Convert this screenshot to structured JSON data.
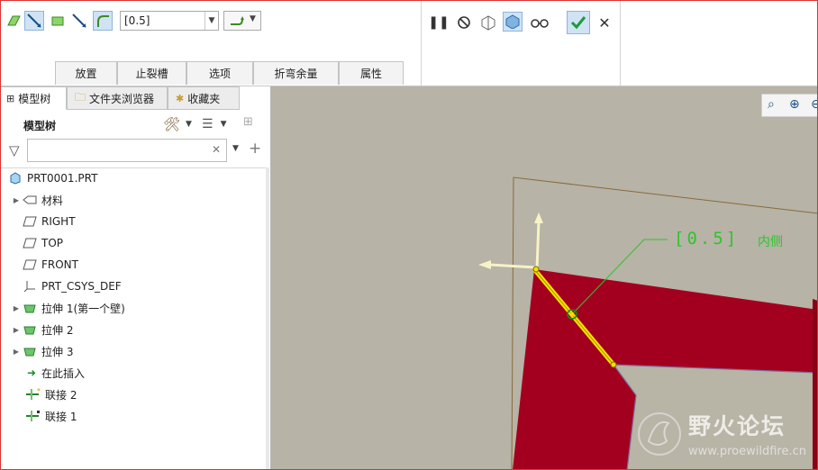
{
  "ribbon": {
    "thickness_value": "[0.5]",
    "tabs": [
      "放置",
      "止裂槽",
      "选项",
      "折弯余量",
      "属性"
    ]
  },
  "model_tree": {
    "tabs": [
      "模型树",
      "文件夹浏览器",
      "收藏夹"
    ],
    "title": "模型树",
    "items": [
      {
        "label": "PRT0001.PRT"
      },
      {
        "label": "材料"
      },
      {
        "label": "RIGHT"
      },
      {
        "label": "TOP"
      },
      {
        "label": "FRONT"
      },
      {
        "label": "PRT_CSYS_DEF"
      },
      {
        "label": "拉伸 1(第一个壁)"
      },
      {
        "label": "拉伸 2"
      },
      {
        "label": "拉伸 3"
      },
      {
        "label": "在此插入"
      },
      {
        "label": "联接 2"
      },
      {
        "label": "联接 1"
      }
    ]
  },
  "viewport": {
    "dimension_value": "[0.5]",
    "dimension_side": "内侧",
    "watermark_title": "野火论坛",
    "watermark_url": "www.proewildfire.cn",
    "colors": {
      "part": "#a3001f",
      "edge": "#f5e000",
      "annotation": "#2ec42e",
      "background": "#b7b3a6"
    }
  }
}
